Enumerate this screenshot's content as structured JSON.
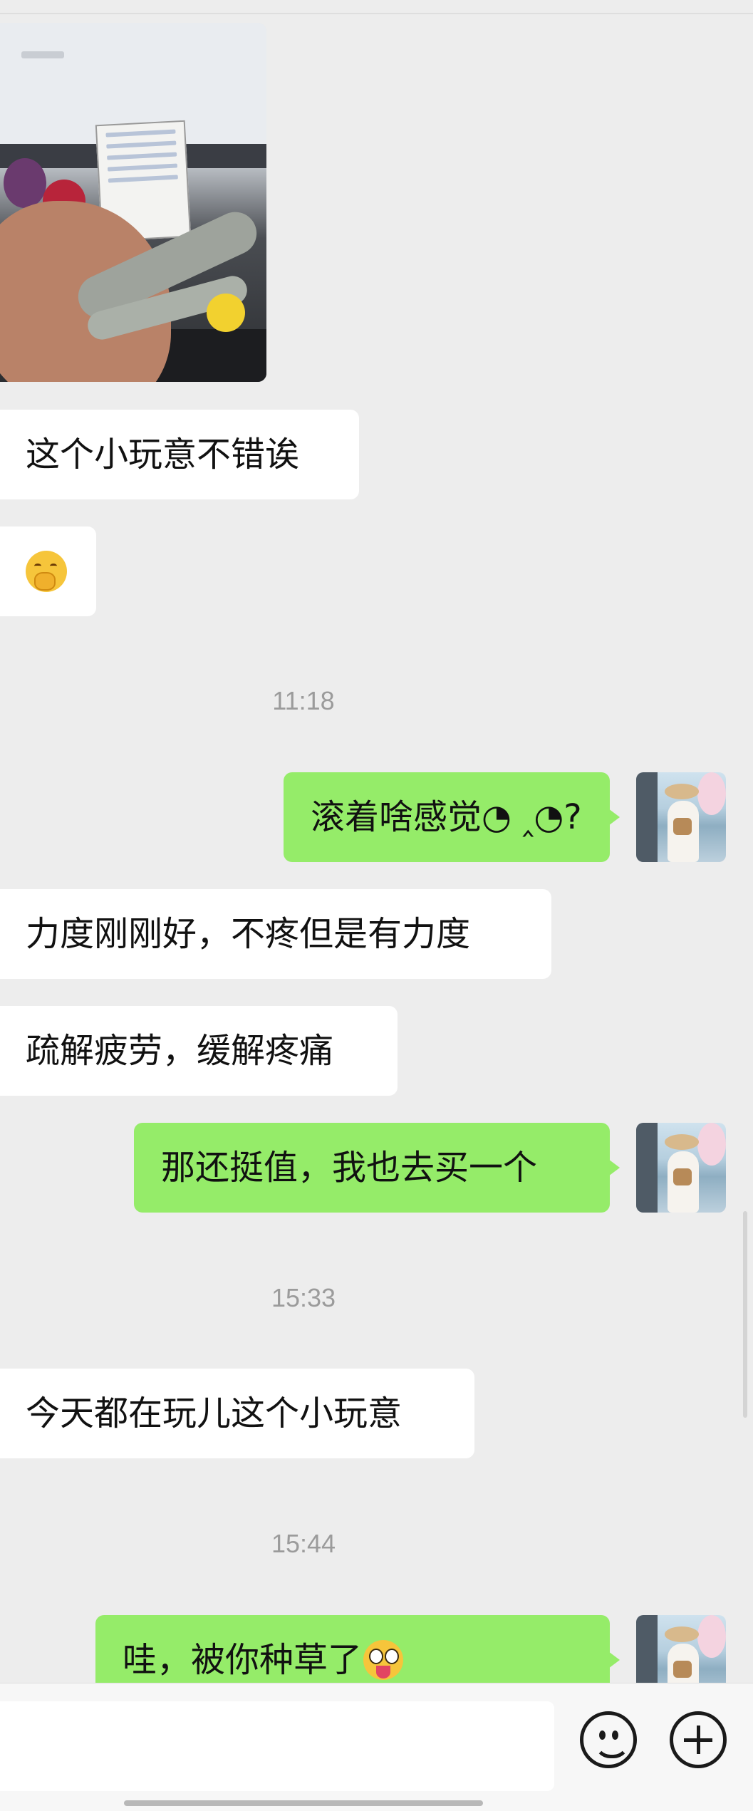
{
  "messages": {
    "m1": "这个小玩意不错诶",
    "m3_time": "11:18",
    "m4": "滚着啥感觉◔ ‸◔?",
    "m5": "力度刚刚好，不疼但是有力度",
    "m6": "疏解疲劳，缓解疼痛",
    "m7": "那还挺值，我也去买一个",
    "m8_time": "15:33",
    "m9": "今天都在玩儿这个小玩意",
    "m10_time": "15:44",
    "m11": "哇，被你种草了"
  },
  "colors": {
    "background": "#ededed",
    "incoming_bubble": "#ffffff",
    "outgoing_bubble": "#95ec69",
    "timestamp": "#9b9b9b"
  },
  "icons": {
    "emoji_reaction": "face-with-hand-over-mouth-icon",
    "tongue": "zany-tongue-face-icon",
    "emoji_button": "smiley-icon",
    "plus_button": "plus-circle-icon"
  }
}
